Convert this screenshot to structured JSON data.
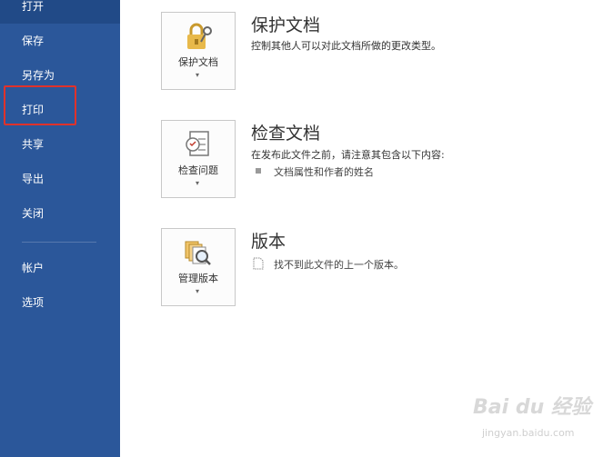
{
  "sidebar": {
    "items": [
      {
        "label": "打开"
      },
      {
        "label": "保存"
      },
      {
        "label": "另存为"
      },
      {
        "label": "打印"
      },
      {
        "label": "共享"
      },
      {
        "label": "导出"
      },
      {
        "label": "关闭"
      },
      {
        "label": "帐户"
      },
      {
        "label": "选项"
      }
    ]
  },
  "sections": {
    "protect": {
      "button_label": "保护文档",
      "title": "保护文档",
      "description": "控制其他人可以对此文档所做的更改类型。",
      "icon": "lock-key-icon"
    },
    "inspect": {
      "button_label": "检查问题",
      "title": "检查文档",
      "description": "在发布此文件之前，请注意其包含以下内容:",
      "item": "文档属性和作者的姓名",
      "icon": "checklist-icon"
    },
    "versions": {
      "button_label": "管理版本",
      "title": "版本",
      "item": "找不到此文件的上一个版本。",
      "icon": "versions-magnifier-icon"
    }
  },
  "watermark": {
    "brand": "Bai du 经验",
    "url": "jingyan.baidu.com"
  },
  "colors": {
    "sidebar": "#2b579a",
    "highlight": "#e0322b"
  }
}
